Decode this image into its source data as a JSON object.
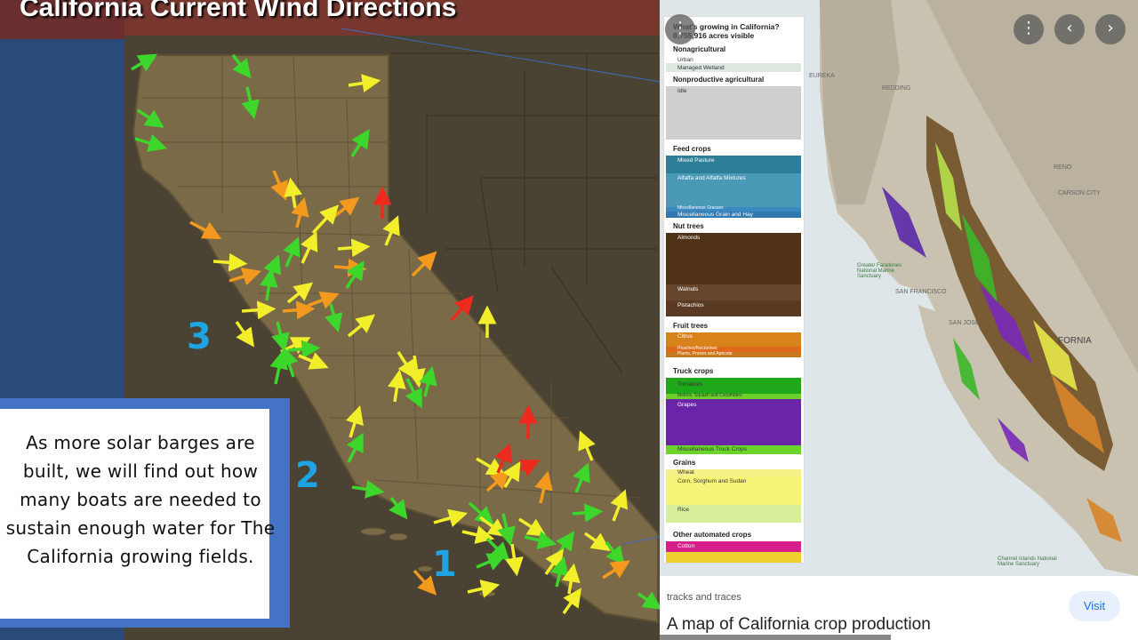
{
  "left_panel": {
    "title": "California Current Wind Directions",
    "zones": [
      "3",
      "2",
      "1"
    ],
    "note": "As more solar barges are built, we will find out how many boats are needed to sustain  enough water for The California growing fields.",
    "colors": {
      "ocean": "#2b4a7c",
      "land": "#7a6a48",
      "neighbor": "#4a4232",
      "border_box": "#4472c4",
      "zone_label": "#1ea3e3"
    }
  },
  "right_panel": {
    "legend": {
      "title": "What's growing in California?",
      "subtitle": "8,755,916 acres visible",
      "sections": [
        {
          "name": "Nonagricultural",
          "items": [
            "Urban",
            "Managed Wetland"
          ]
        },
        {
          "name": "Nonproductive agricultural",
          "items": [
            "Idle"
          ]
        },
        {
          "name": "Feed crops",
          "items": [
            "Mixed Pasture",
            "Alfalfa and Alfalfa Mixtures",
            "Miscellaneous Grasses",
            "Miscellaneous Grain and Hay"
          ]
        },
        {
          "name": "Nut trees",
          "items": [
            "Almonds",
            "Walnuts",
            "Pistachios"
          ]
        },
        {
          "name": "Fruit trees",
          "items": [
            "Citrus",
            "Peaches/Nectarines",
            "Plums, Prunes and Apricots"
          ]
        },
        {
          "name": "Truck crops",
          "items": [
            "Tomatoes",
            "Melons, Squash and Cucumbers",
            "Grapes",
            "Miscellaneous Truck Crops"
          ]
        },
        {
          "name": "Grains",
          "items": [
            "Wheat",
            "Corn, Sorghum and Sudan",
            "Rice"
          ]
        },
        {
          "name": "Other automated crops",
          "items": [
            "Cotton"
          ]
        }
      ]
    },
    "place_labels": [
      "EUREKA",
      "REDDING",
      "RENO",
      "CARSON CITY",
      "SAN FRANCISCO",
      "SAN JOSE",
      "FORNIA",
      "Greater Farallones National Marine Sanctuary",
      "Channel Islands National Marine Sanctuary"
    ],
    "controls": [
      "more-icon",
      "prev-icon",
      "next-icon"
    ],
    "source": "tracks and traces",
    "caption": "A map of California crop production",
    "visit_label": "Visit"
  }
}
